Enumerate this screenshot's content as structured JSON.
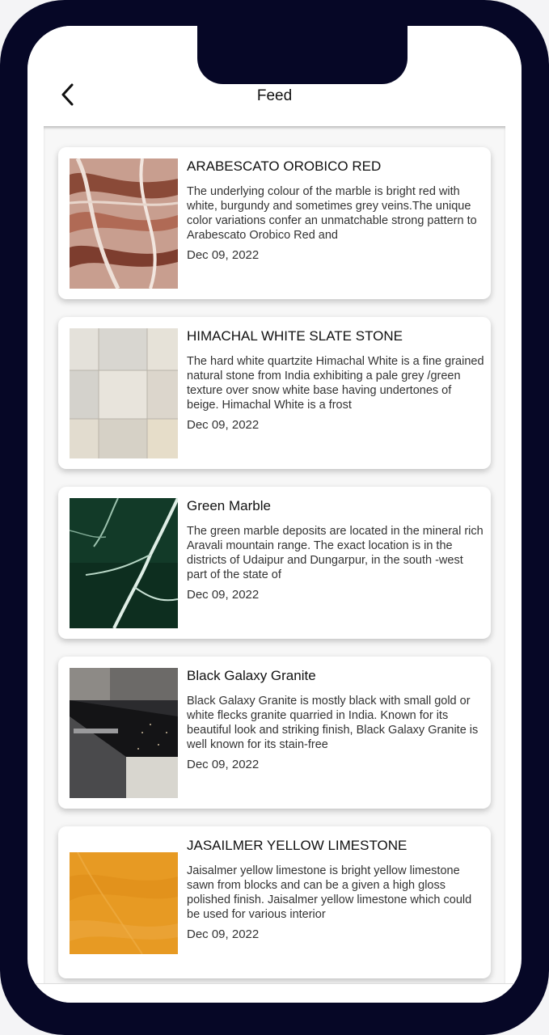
{
  "header": {
    "title": "Feed",
    "back_icon": "chevron-left-icon"
  },
  "feed": {
    "items": [
      {
        "title": "ARABESCATO OROBICO RED",
        "description": "The underlying colour of the marble is bright red with white, burgundy and sometimes grey veins.The unique color variations confer an unmatchable strong pattern to Arabescato Orobico Red and",
        "date": "Dec 09, 2022"
      },
      {
        "title": " HIMACHAL WHITE SLATE STONE",
        "description": "The hard white quartzite Himachal White is a fine grained natural stone from India exhibiting a pale grey /green texture over snow white base having undertones of beige. Himachal White is a frost",
        "date": "Dec 09, 2022"
      },
      {
        "title": "Green Marble",
        "description": "The green marble deposits are located in the mineral rich Aravali mountain range. The exact location is in the districts of Udaipur and Dungarpur, in the south -west part of the state of",
        "date": "Dec 09, 2022"
      },
      {
        "title": "Black Galaxy Granite",
        "description": "Black Galaxy Granite is mostly black with small gold or white flecks granite quarried in India. Known for its beautiful look and striking finish, Black Galaxy Granite is well known for its stain-free",
        "date": "Dec 09, 2022",
        "image_watermark": "rkmarblesindia"
      },
      {
        "title": "JASAILMER YELLOW LIMESTONE",
        "description": "Jaisalmer yellow limestone is bright yellow limestone sawn from blocks and can be a given a high gloss polished finish. Jaisalmer yellow limestone which could be used for various interior",
        "date": "Dec 09, 2022"
      }
    ]
  },
  "colors": {
    "frame": "#060726",
    "background": "#ffffff",
    "feed_background": "#f7f7f7"
  }
}
